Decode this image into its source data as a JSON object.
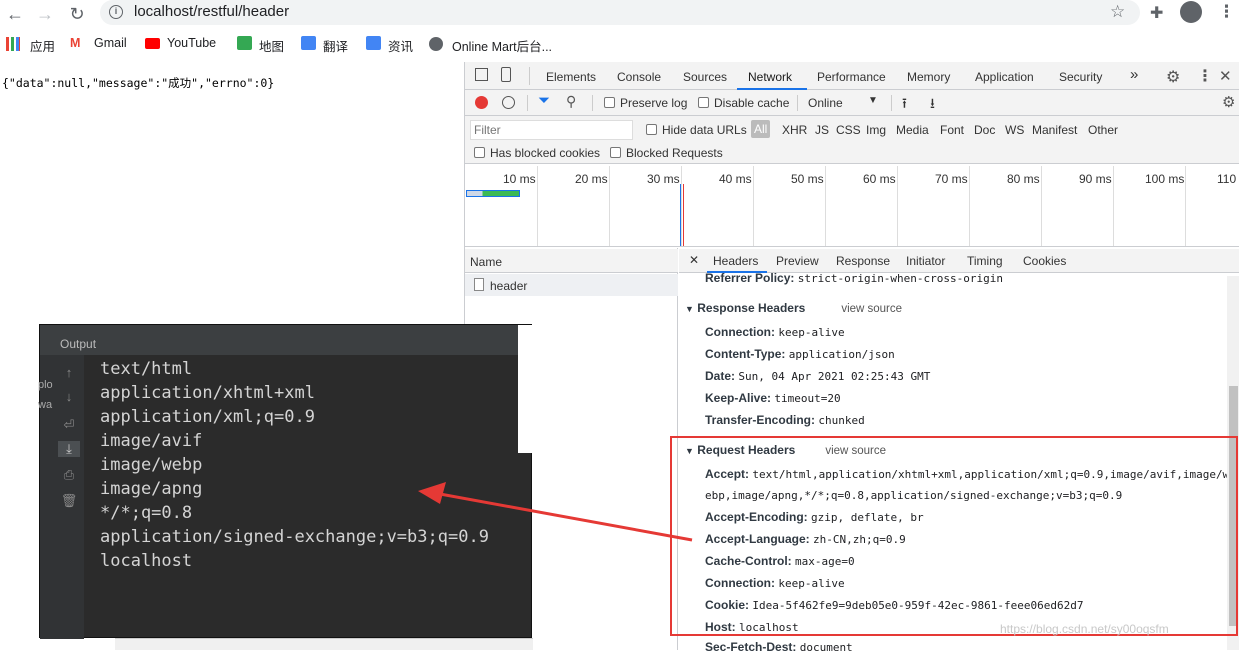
{
  "browser": {
    "url": "localhost/restful/header",
    "bookmarks": [
      "应用",
      "Gmail",
      "YouTube",
      "地图",
      "翻译",
      "资讯",
      "Online Mart后台..."
    ]
  },
  "page": {
    "json_text": "{\"data\":null,\"message\":\"成功\",\"errno\":0}"
  },
  "devtools": {
    "tabs": [
      "Elements",
      "Console",
      "Sources",
      "Network",
      "Performance",
      "Memory",
      "Application",
      "Security"
    ],
    "active_tab": "Network",
    "more": "»",
    "toolbar": {
      "preserve_log": "Preserve log",
      "disable_cache": "Disable cache",
      "throttle": "Online"
    },
    "filter": {
      "placeholder": "Filter",
      "hide_data_urls": "Hide data URLs",
      "types": [
        "All",
        "XHR",
        "JS",
        "CSS",
        "Img",
        "Media",
        "Font",
        "Doc",
        "WS",
        "Manifest",
        "Other"
      ]
    },
    "filter2": [
      "Has blocked cookies",
      "Blocked Requests"
    ],
    "timeline_ticks": [
      "10 ms",
      "20 ms",
      "30 ms",
      "40 ms",
      "50 ms",
      "60 ms",
      "70 ms",
      "80 ms",
      "90 ms",
      "100 ms",
      "110"
    ],
    "name_column": "Name",
    "request_name": "header",
    "detail_tabs": [
      "Headers",
      "Preview",
      "Response",
      "Initiator",
      "Timing",
      "Cookies"
    ],
    "referrer": {
      "key": "Referrer Policy:",
      "value": "strict-origin-when-cross-origin"
    },
    "response_headers_title": "Response Headers",
    "view_source": "view source",
    "response_headers": [
      {
        "k": "Connection:",
        "v": "keep-alive"
      },
      {
        "k": "Content-Type:",
        "v": "application/json"
      },
      {
        "k": "Date:",
        "v": "Sun, 04 Apr 2021 02:25:43 GMT"
      },
      {
        "k": "Keep-Alive:",
        "v": "timeout=20"
      },
      {
        "k": "Transfer-Encoding:",
        "v": "chunked"
      }
    ],
    "request_headers_title": "Request Headers",
    "accept": {
      "k": "Accept:",
      "v1": "text/html,application/xhtml+xml,application/xml;q=0.9,image/avif,image/w",
      "v2": "ebp,image/apng,*/*;q=0.8,application/signed-exchange;v=b3;q=0.9"
    },
    "request_headers": [
      {
        "k": "Accept-Encoding:",
        "v": "gzip, deflate, br"
      },
      {
        "k": "Accept-Language:",
        "v": "zh-CN,zh;q=0.9"
      },
      {
        "k": "Cache-Control:",
        "v": "max-age=0"
      },
      {
        "k": "Connection:",
        "v": "keep-alive"
      },
      {
        "k": "Cookie:",
        "v": "Idea-5f462fe9=9deb05e0-959f-42ec-9861-feee06ed62d7"
      },
      {
        "k": "Host:",
        "v": "localhost"
      }
    ],
    "cutoff": {
      "k": "Sec-Fetch-Dest:",
      "v": "document"
    }
  },
  "output": {
    "title": "Output",
    "lines": [
      "text/html",
      "application/xhtml+xml",
      "application/xml;q=0.9",
      "image/avif",
      "image/webp",
      "image/apng",
      "*/*;q=0.8",
      "application/signed-exchange;v=b3;q=0.9",
      "localhost"
    ],
    "behind": [
      "plo",
      "wa"
    ]
  },
  "watermark": "https://blog.csdn.net/sy00oqsfm",
  "colors": {
    "highlight_box": "#e53935",
    "arrow": "#e53935",
    "active_tab_underline": "#1a73e8"
  }
}
